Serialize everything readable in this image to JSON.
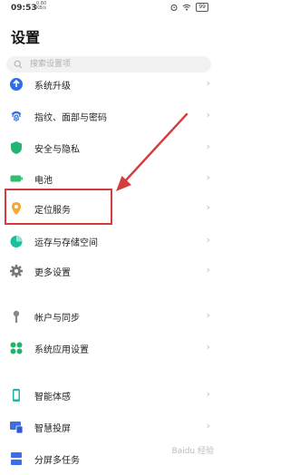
{
  "status_bar": {
    "time": "09:53",
    "speed_value": "0.80",
    "speed_unit": "KB/s",
    "battery": "99"
  },
  "header": {
    "title": "设置"
  },
  "search": {
    "placeholder": "搜索设置项"
  },
  "settings": [
    {
      "label": "系统升级",
      "icon": "system-update-icon",
      "color": "#2f6fe4"
    },
    {
      "label": "指纹、面部与密码",
      "icon": "fingerprint-icon",
      "color": "#2f6fe4"
    },
    {
      "label": "安全与隐私",
      "icon": "shield-icon",
      "color": "#22b573"
    },
    {
      "label": "电池",
      "icon": "battery-icon",
      "color": "#2fbf71"
    },
    {
      "label": "定位服务",
      "icon": "location-pin-icon",
      "color": "#f4a83a"
    },
    {
      "label": "运存与存储空间",
      "icon": "storage-pie-icon",
      "color": "#1bbf9c"
    },
    {
      "label": "更多设置",
      "icon": "gear-icon",
      "color": "#777777"
    },
    {
      "label": "帐户与同步",
      "icon": "account-pin-icon",
      "color": "#888888"
    },
    {
      "label": "系统应用设置",
      "icon": "apps-grid-icon",
      "color": "#21b26f"
    },
    {
      "label": "智能体感",
      "icon": "phone-gesture-icon",
      "color": "#1fb6a7"
    },
    {
      "label": "智慧投屏",
      "icon": "screen-cast-icon",
      "color": "#3b6ee8"
    },
    {
      "label": "分屏多任务",
      "icon": "split-screen-icon",
      "color": "#3b6ee8"
    }
  ],
  "watermark": "Baidu 经验"
}
